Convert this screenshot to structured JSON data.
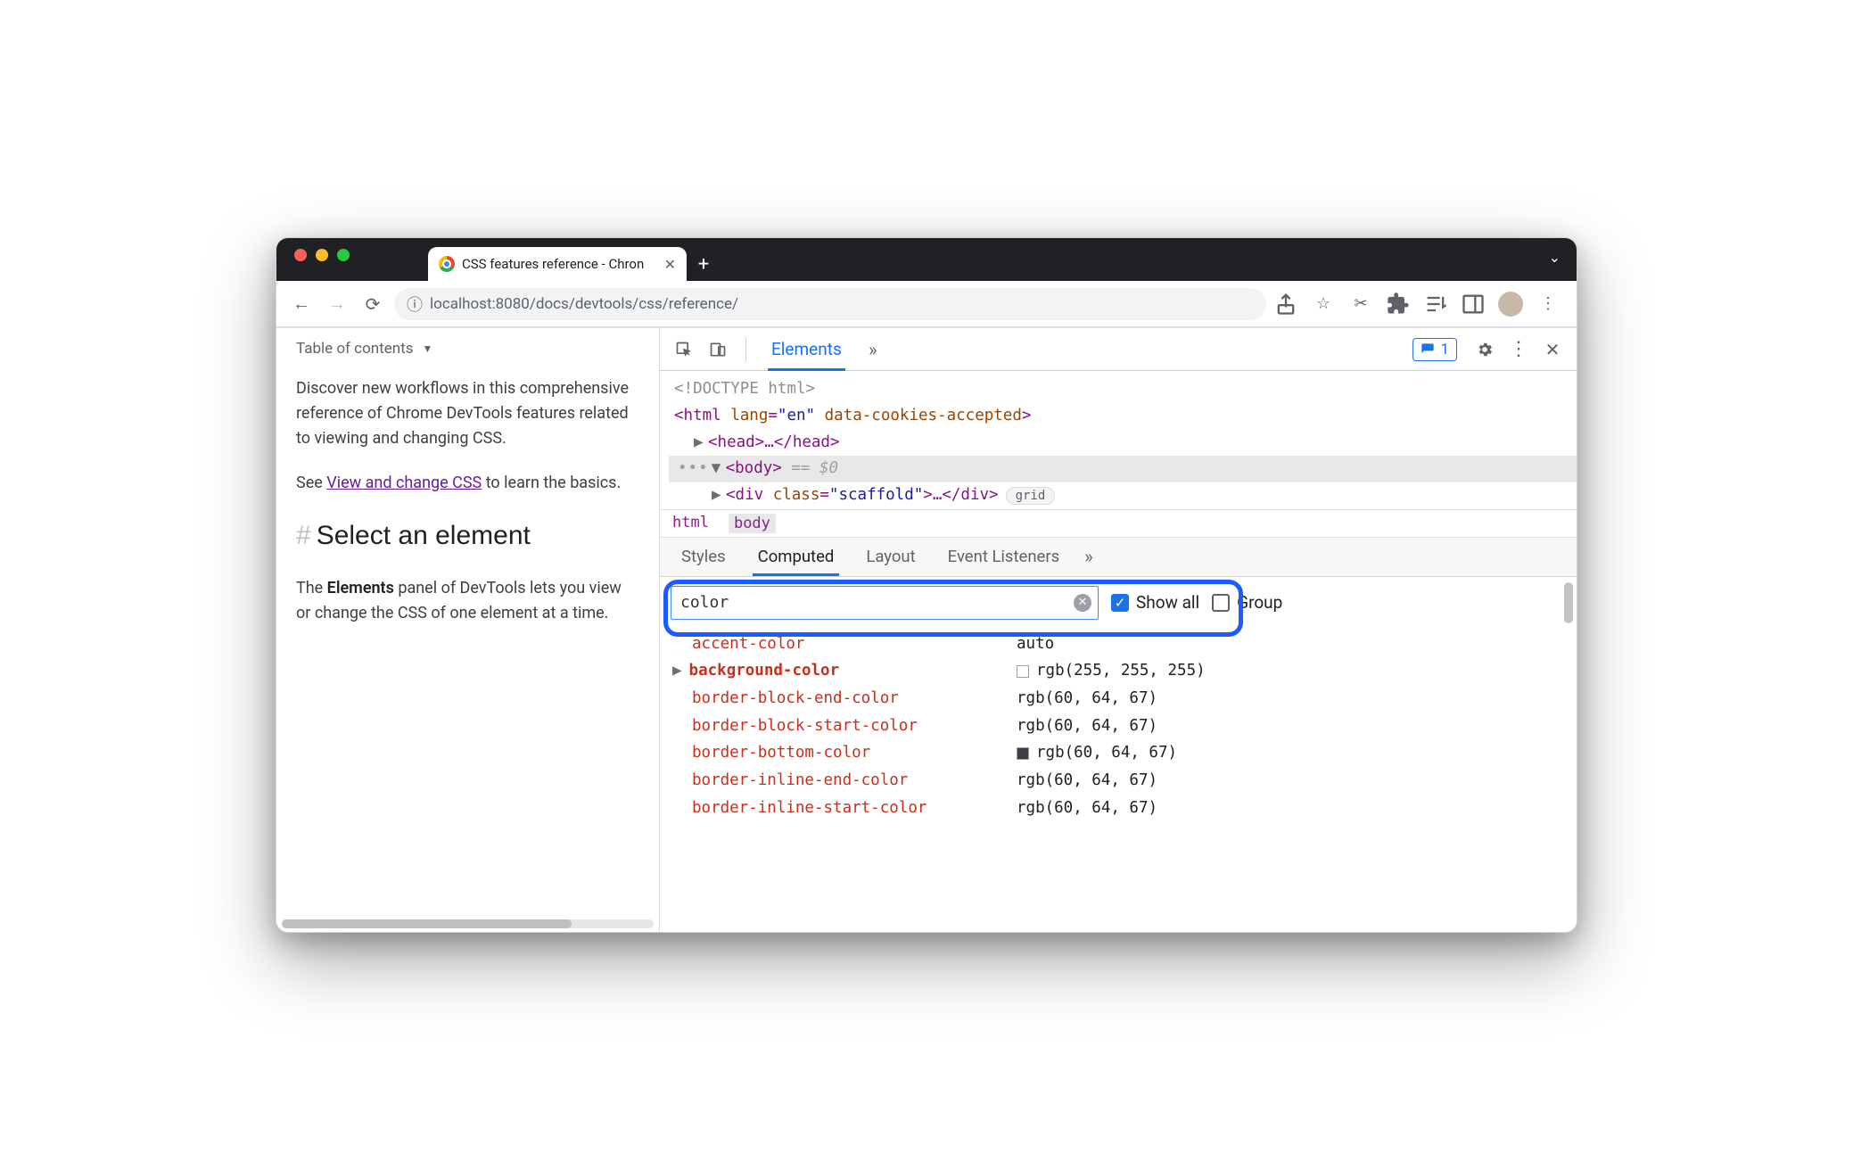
{
  "browser": {
    "tab_title": "CSS features reference - Chron",
    "url_host": "localhost",
    "url_port": ":8080",
    "url_path": "/docs/devtools/css/reference/"
  },
  "page": {
    "toc_label": "Table of contents",
    "intro": "Discover new workflows in this comprehensive reference of Chrome DevTools features related to viewing and changing CSS.",
    "see_prefix": "See ",
    "see_link": "View and change CSS",
    "see_suffix": " to learn the basics.",
    "h2_hash": "#",
    "h2": "Select an element",
    "body_prefix": "The ",
    "body_strong": "Elements",
    "body_suffix": " panel of DevTools lets you view or change the CSS of one element at a time."
  },
  "devtools": {
    "tab_elements": "Elements",
    "issues_count": "1",
    "dom": {
      "doctype": "<!DOCTYPE html>",
      "html_open": "<html ",
      "html_attr1_name": "lang",
      "html_attr1_val": "\"en\"",
      "html_attr2_name": "data-cookies-accepted",
      "html_close": ">",
      "head": "<head>…</head>",
      "body_open": "<body>",
      "eq0": " == $0",
      "div_open": "<div ",
      "div_attr_name": "class",
      "div_attr_val": "\"scaffold\"",
      "div_rest": ">…</div>",
      "div_pill": "grid"
    },
    "crumb_html": "html",
    "crumb_body": "body",
    "subtabs": {
      "styles": "Styles",
      "computed": "Computed",
      "layout": "Layout",
      "listeners": "Event Listeners"
    },
    "filter_value": "color",
    "show_all_label": "Show all",
    "group_label": "Group",
    "computed": [
      {
        "prop": "accent-color",
        "val": "auto",
        "expandable": false,
        "swatch": null,
        "strong": false
      },
      {
        "prop": "background-color",
        "val": "rgb(255, 255, 255)",
        "expandable": true,
        "swatch": "#ffffff",
        "strong": true
      },
      {
        "prop": "border-block-end-color",
        "val": "rgb(60, 64, 67)",
        "expandable": false,
        "swatch": null,
        "strong": false
      },
      {
        "prop": "border-block-start-color",
        "val": "rgb(60, 64, 67)",
        "expandable": false,
        "swatch": null,
        "strong": false
      },
      {
        "prop": "border-bottom-color",
        "val": "rgb(60, 64, 67)",
        "expandable": false,
        "swatch": "#3c4043",
        "strong": false
      },
      {
        "prop": "border-inline-end-color",
        "val": "rgb(60, 64, 67)",
        "expandable": false,
        "swatch": null,
        "strong": false
      },
      {
        "prop": "border-inline-start-color",
        "val": "rgb(60, 64, 67)",
        "expandable": false,
        "swatch": null,
        "strong": false
      }
    ]
  }
}
